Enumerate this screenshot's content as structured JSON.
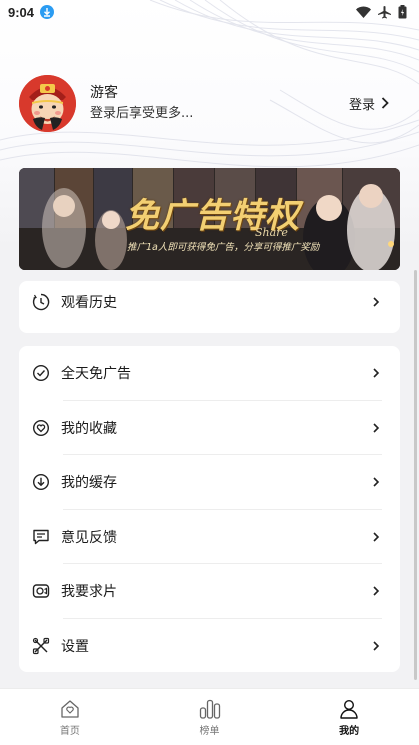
{
  "status_bar": {
    "time": "9:04"
  },
  "profile": {
    "name": "游客",
    "subtitle": "登录后享受更多...",
    "login_label": "登录"
  },
  "banner": {
    "title": "免广告特权",
    "script_text": "Share",
    "subtitle": "推广1a人即可获得免广告，分享可得推广奖励"
  },
  "history": {
    "label": "观看历史",
    "icon": "clock-icon"
  },
  "menu": [
    {
      "label": "全天免广告",
      "icon": "check-badge-icon"
    },
    {
      "label": "我的收藏",
      "icon": "heart-icon"
    },
    {
      "label": "我的缓存",
      "icon": "download-icon"
    },
    {
      "label": "意见反馈",
      "icon": "feedback-icon"
    },
    {
      "label": "我要求片",
      "icon": "video-request-icon"
    },
    {
      "label": "设置",
      "icon": "tools-icon"
    }
  ],
  "tabbar": [
    {
      "label": "首页",
      "icon": "home-icon",
      "active": false
    },
    {
      "label": "榜单",
      "icon": "ranking-icon",
      "active": false
    },
    {
      "label": "我的",
      "icon": "profile-icon",
      "active": true
    }
  ],
  "colors": {
    "accent_download": "#2b9cf2",
    "banner_gold": "#f3cf72"
  }
}
